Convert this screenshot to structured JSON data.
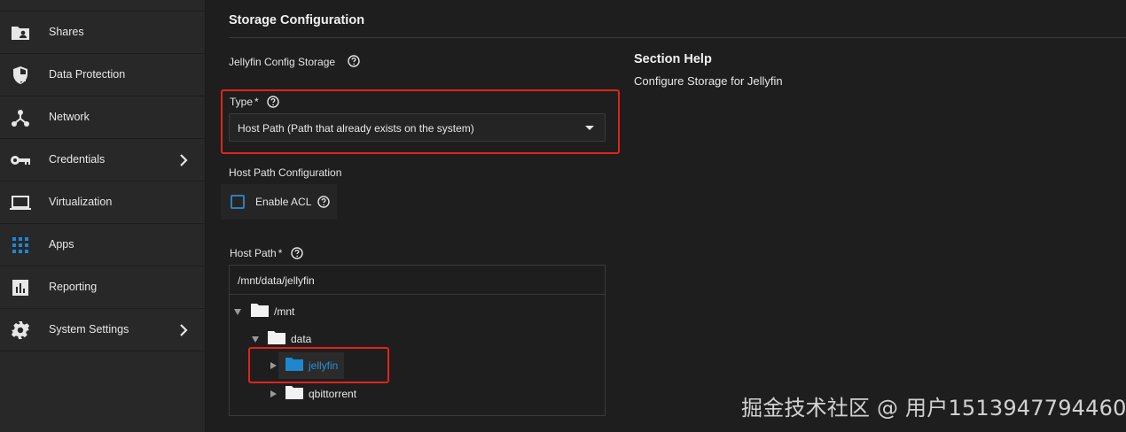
{
  "sidebar": {
    "items": [
      {
        "label": "Shares",
        "icon": "folder-user-icon",
        "has_chevron": false
      },
      {
        "label": "Data Protection",
        "icon": "shield-icon",
        "has_chevron": false
      },
      {
        "label": "Network",
        "icon": "network-hub-icon",
        "has_chevron": false
      },
      {
        "label": "Credentials",
        "icon": "key-icon",
        "has_chevron": true
      },
      {
        "label": "Virtualization",
        "icon": "laptop-icon",
        "has_chevron": false
      },
      {
        "label": "Apps",
        "icon": "apps-grid-icon",
        "has_chevron": false
      },
      {
        "label": "Reporting",
        "icon": "bar-chart-icon",
        "has_chevron": false
      },
      {
        "label": "System Settings",
        "icon": "gear-icon",
        "has_chevron": true
      }
    ]
  },
  "form": {
    "section_title": "Storage Configuration",
    "config_storage_label": "Jellyfin Config Storage",
    "type_label": "Type",
    "required_mark": "*",
    "type_value": "Host Path (Path that already exists on the system)",
    "host_path_config_label": "Host Path Configuration",
    "enable_acl_label": "Enable ACL",
    "enable_acl_checked": false,
    "host_path_label": "Host Path",
    "host_path_value": "/mnt/data/jellyfin",
    "tree": {
      "root": "/mnt",
      "child": "data",
      "selected": "jellyfin",
      "sibling": "qbittorrent"
    }
  },
  "help": {
    "title": "Section Help",
    "text": "Configure Storage for Jellyfin"
  },
  "watermark": "掘金技术社区 @ 用户1513947794460",
  "colors": {
    "sidebar_bg": "#282828",
    "main_bg": "#1e1e1e",
    "accent_blue": "#2a8fd6",
    "highlight_red": "#e0241c",
    "apps_icon_blue": "#1f86d0"
  }
}
